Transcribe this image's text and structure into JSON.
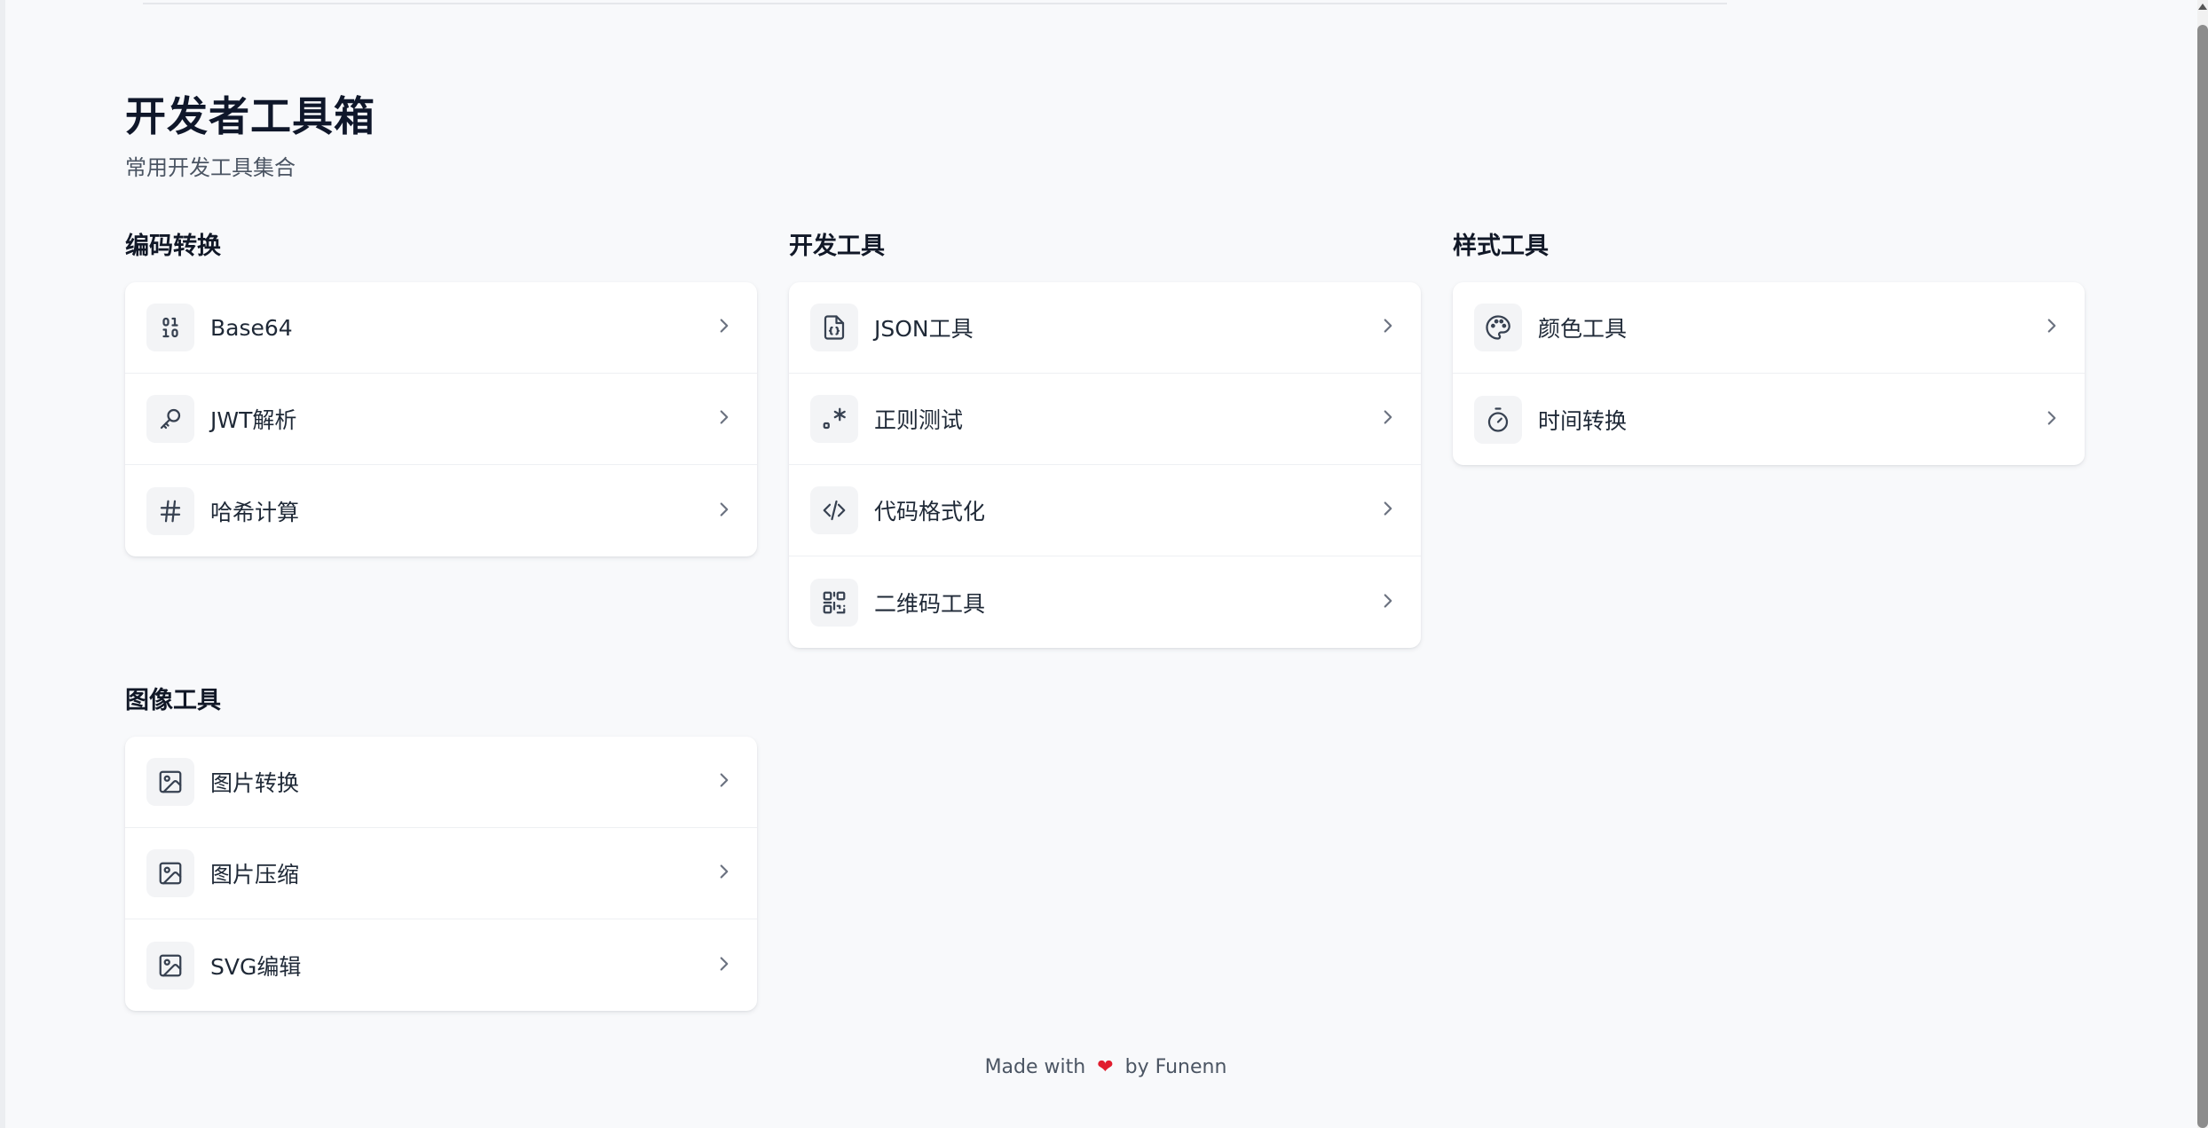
{
  "header": {
    "title": "开发者工具箱",
    "subtitle": "常用开发工具集合"
  },
  "sections": [
    {
      "title": "编码转换",
      "items": [
        {
          "label": "Base64",
          "icon": "binary-icon"
        },
        {
          "label": "JWT解析",
          "icon": "key-icon"
        },
        {
          "label": "哈希计算",
          "icon": "hash-icon"
        }
      ]
    },
    {
      "title": "开发工具",
      "items": [
        {
          "label": "JSON工具",
          "icon": "file-json-icon"
        },
        {
          "label": "正则测试",
          "icon": "regex-icon"
        },
        {
          "label": "代码格式化",
          "icon": "code-icon"
        },
        {
          "label": "二维码工具",
          "icon": "qr-code-icon"
        }
      ]
    },
    {
      "title": "样式工具",
      "items": [
        {
          "label": "颜色工具",
          "icon": "palette-icon"
        },
        {
          "label": "时间转换",
          "icon": "timer-icon"
        }
      ]
    },
    {
      "title": "图像工具",
      "items": [
        {
          "label": "图片转换",
          "icon": "image-icon"
        },
        {
          "label": "图片压缩",
          "icon": "image-icon"
        },
        {
          "label": "SVG编辑",
          "icon": "image-icon"
        }
      ]
    }
  ],
  "footer": {
    "prefix": "Made with",
    "heart": "❤",
    "suffix": "by Funenn"
  },
  "colors": {
    "background": "#f8f9fb",
    "card": "#ffffff",
    "icon_bg": "#f3f4f6",
    "heart": "#e11d2e"
  }
}
